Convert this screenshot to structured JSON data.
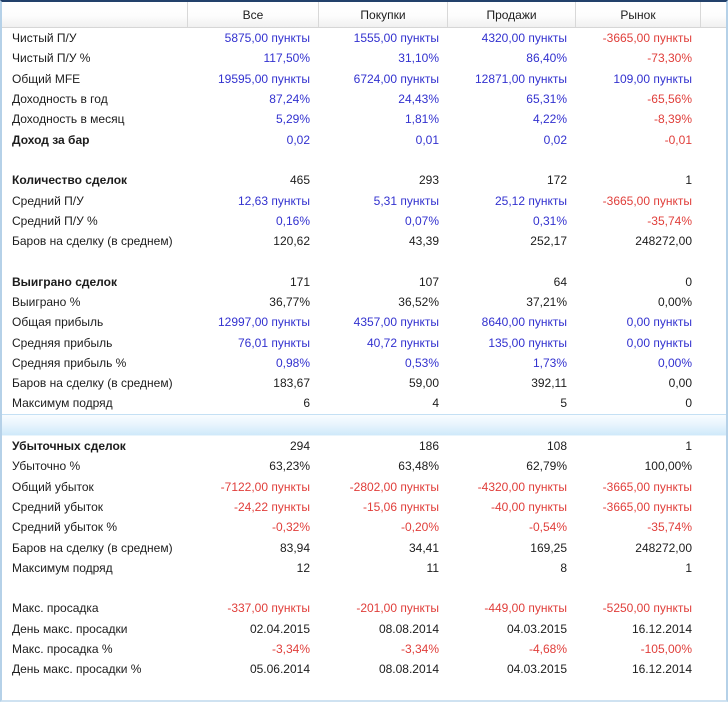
{
  "panel": {
    "columns": [
      "Все",
      "Покупки",
      "Продажи",
      "Рынок"
    ],
    "colors": {
      "positive_value": "#3231cf",
      "negative_value": "#e03e3a",
      "neutral_value": "#1c1c1c",
      "header_top_border": "#22416b",
      "panel_side_border": "#b5d1e8",
      "selected_row_highlight": "#cfe9fa"
    },
    "rows": [
      {
        "type": "data",
        "bold": false,
        "label": "Чистый П/У",
        "values": [
          {
            "t": "5875,00 пункты",
            "c": "b"
          },
          {
            "t": "1555,00 пункты",
            "c": "b"
          },
          {
            "t": "4320,00 пункты",
            "c": "b"
          },
          {
            "t": "-3665,00 пункты",
            "c": "r"
          }
        ]
      },
      {
        "type": "data",
        "bold": false,
        "label": "Чистый П/У %",
        "values": [
          {
            "t": "117,50%",
            "c": "b"
          },
          {
            "t": "31,10%",
            "c": "b"
          },
          {
            "t": "86,40%",
            "c": "b"
          },
          {
            "t": "-73,30%",
            "c": "r"
          }
        ]
      },
      {
        "type": "data",
        "bold": false,
        "label": "Общий MFE",
        "values": [
          {
            "t": "19595,00 пункты",
            "c": "b"
          },
          {
            "t": "6724,00 пункты",
            "c": "b"
          },
          {
            "t": "12871,00 пункты",
            "c": "b"
          },
          {
            "t": "109,00 пункты",
            "c": "b"
          }
        ]
      },
      {
        "type": "data",
        "bold": false,
        "label": "Доходность в год",
        "values": [
          {
            "t": "87,24%",
            "c": "b"
          },
          {
            "t": "24,43%",
            "c": "b"
          },
          {
            "t": "65,31%",
            "c": "b"
          },
          {
            "t": "-65,56%",
            "c": "r"
          }
        ]
      },
      {
        "type": "data",
        "bold": false,
        "label": "Доходность в месяц",
        "values": [
          {
            "t": "5,29%",
            "c": "b"
          },
          {
            "t": "1,81%",
            "c": "b"
          },
          {
            "t": "4,22%",
            "c": "b"
          },
          {
            "t": "-8,39%",
            "c": "r"
          }
        ]
      },
      {
        "type": "data",
        "bold": true,
        "label": "Доход за бар",
        "values": [
          {
            "t": "0,02",
            "c": "b"
          },
          {
            "t": "0,01",
            "c": "b"
          },
          {
            "t": "0,02",
            "c": "b"
          },
          {
            "t": "-0,01",
            "c": "r"
          }
        ]
      },
      {
        "type": "sp"
      },
      {
        "type": "data",
        "bold": true,
        "label": "Количество сделок",
        "values": [
          {
            "t": "465",
            "c": "k"
          },
          {
            "t": "293",
            "c": "k"
          },
          {
            "t": "172",
            "c": "k"
          },
          {
            "t": "1",
            "c": "k"
          }
        ]
      },
      {
        "type": "data",
        "bold": false,
        "label": "Средний П/У",
        "values": [
          {
            "t": "12,63 пункты",
            "c": "b"
          },
          {
            "t": "5,31 пункты",
            "c": "b"
          },
          {
            "t": "25,12 пункты",
            "c": "b"
          },
          {
            "t": "-3665,00 пункты",
            "c": "r"
          }
        ]
      },
      {
        "type": "data",
        "bold": false,
        "label": "Средний П/У %",
        "values": [
          {
            "t": "0,16%",
            "c": "b"
          },
          {
            "t": "0,07%",
            "c": "b"
          },
          {
            "t": "0,31%",
            "c": "b"
          },
          {
            "t": "-35,74%",
            "c": "r"
          }
        ]
      },
      {
        "type": "data",
        "bold": false,
        "label": "Баров на сделку (в среднем)",
        "values": [
          {
            "t": "120,62",
            "c": "k"
          },
          {
            "t": "43,39",
            "c": "k"
          },
          {
            "t": "252,17",
            "c": "k"
          },
          {
            "t": "248272,00",
            "c": "k"
          }
        ]
      },
      {
        "type": "sp"
      },
      {
        "type": "data",
        "bold": true,
        "label": "Выиграно сделок",
        "values": [
          {
            "t": "171",
            "c": "k"
          },
          {
            "t": "107",
            "c": "k"
          },
          {
            "t": "64",
            "c": "k"
          },
          {
            "t": "0",
            "c": "k"
          }
        ]
      },
      {
        "type": "data",
        "bold": false,
        "label": "Выиграно %",
        "values": [
          {
            "t": "36,77%",
            "c": "k"
          },
          {
            "t": "36,52%",
            "c": "k"
          },
          {
            "t": "37,21%",
            "c": "k"
          },
          {
            "t": "0,00%",
            "c": "k"
          }
        ]
      },
      {
        "type": "data",
        "bold": false,
        "label": "Общая прибыль",
        "values": [
          {
            "t": "12997,00 пункты",
            "c": "b"
          },
          {
            "t": "4357,00 пункты",
            "c": "b"
          },
          {
            "t": "8640,00 пункты",
            "c": "b"
          },
          {
            "t": "0,00 пункты",
            "c": "b"
          }
        ]
      },
      {
        "type": "data",
        "bold": false,
        "label": "Средняя прибыль",
        "values": [
          {
            "t": "76,01 пункты",
            "c": "b"
          },
          {
            "t": "40,72 пункты",
            "c": "b"
          },
          {
            "t": "135,00 пункты",
            "c": "b"
          },
          {
            "t": "0,00 пункты",
            "c": "b"
          }
        ]
      },
      {
        "type": "data",
        "bold": false,
        "label": "Средняя прибыль %",
        "values": [
          {
            "t": "0,98%",
            "c": "b"
          },
          {
            "t": "0,53%",
            "c": "b"
          },
          {
            "t": "1,73%",
            "c": "b"
          },
          {
            "t": "0,00%",
            "c": "b"
          }
        ]
      },
      {
        "type": "data",
        "bold": false,
        "label": "Баров на сделку (в среднем)",
        "values": [
          {
            "t": "183,67",
            "c": "k"
          },
          {
            "t": "59,00",
            "c": "k"
          },
          {
            "t": "392,11",
            "c": "k"
          },
          {
            "t": "0,00",
            "c": "k"
          }
        ]
      },
      {
        "type": "data",
        "bold": false,
        "label": "Максимум подряд",
        "values": [
          {
            "t": "6",
            "c": "k"
          },
          {
            "t": "4",
            "c": "k"
          },
          {
            "t": "5",
            "c": "k"
          },
          {
            "t": "0",
            "c": "k"
          }
        ]
      },
      {
        "type": "hl"
      },
      {
        "type": "data",
        "bold": true,
        "label": "Убыточных сделок",
        "values": [
          {
            "t": "294",
            "c": "k"
          },
          {
            "t": "186",
            "c": "k"
          },
          {
            "t": "108",
            "c": "k"
          },
          {
            "t": "1",
            "c": "k"
          }
        ]
      },
      {
        "type": "data",
        "bold": false,
        "label": "Убыточно %",
        "values": [
          {
            "t": "63,23%",
            "c": "k"
          },
          {
            "t": "63,48%",
            "c": "k"
          },
          {
            "t": "62,79%",
            "c": "k"
          },
          {
            "t": "100,00%",
            "c": "k"
          }
        ]
      },
      {
        "type": "data",
        "bold": false,
        "label": "Общий убыток",
        "values": [
          {
            "t": "-7122,00 пункты",
            "c": "r"
          },
          {
            "t": "-2802,00 пункты",
            "c": "r"
          },
          {
            "t": "-4320,00 пункты",
            "c": "r"
          },
          {
            "t": "-3665,00 пункты",
            "c": "r"
          }
        ]
      },
      {
        "type": "data",
        "bold": false,
        "label": "Средний убыток",
        "values": [
          {
            "t": "-24,22 пункты",
            "c": "r"
          },
          {
            "t": "-15,06 пункты",
            "c": "r"
          },
          {
            "t": "-40,00 пункты",
            "c": "r"
          },
          {
            "t": "-3665,00 пункты",
            "c": "r"
          }
        ]
      },
      {
        "type": "data",
        "bold": false,
        "label": "Средний убыток %",
        "values": [
          {
            "t": "-0,32%",
            "c": "r"
          },
          {
            "t": "-0,20%",
            "c": "r"
          },
          {
            "t": "-0,54%",
            "c": "r"
          },
          {
            "t": "-35,74%",
            "c": "r"
          }
        ]
      },
      {
        "type": "data",
        "bold": false,
        "label": "Баров на сделку (в среднем)",
        "values": [
          {
            "t": "83,94",
            "c": "k"
          },
          {
            "t": "34,41",
            "c": "k"
          },
          {
            "t": "169,25",
            "c": "k"
          },
          {
            "t": "248272,00",
            "c": "k"
          }
        ]
      },
      {
        "type": "data",
        "bold": false,
        "label": "Максимум подряд",
        "values": [
          {
            "t": "12",
            "c": "k"
          },
          {
            "t": "11",
            "c": "k"
          },
          {
            "t": "8",
            "c": "k"
          },
          {
            "t": "1",
            "c": "k"
          }
        ]
      },
      {
        "type": "sp"
      },
      {
        "type": "data",
        "bold": false,
        "label": "Макс. просадка",
        "values": [
          {
            "t": "-337,00 пункты",
            "c": "r"
          },
          {
            "t": "-201,00 пункты",
            "c": "r"
          },
          {
            "t": "-449,00 пункты",
            "c": "r"
          },
          {
            "t": "-5250,00 пункты",
            "c": "r"
          }
        ]
      },
      {
        "type": "data",
        "bold": false,
        "label": "День макс. просадки",
        "values": [
          {
            "t": "02.04.2015",
            "c": "k"
          },
          {
            "t": "08.08.2014",
            "c": "k"
          },
          {
            "t": "04.03.2015",
            "c": "k"
          },
          {
            "t": "16.12.2014",
            "c": "k"
          }
        ]
      },
      {
        "type": "data",
        "bold": false,
        "label": "Макс. просадка %",
        "values": [
          {
            "t": "-3,34%",
            "c": "r"
          },
          {
            "t": "-3,34%",
            "c": "r"
          },
          {
            "t": "-4,68%",
            "c": "r"
          },
          {
            "t": "-105,00%",
            "c": "r"
          }
        ]
      },
      {
        "type": "data",
        "bold": false,
        "label": "День макс. просадки %",
        "values": [
          {
            "t": "05.06.2014",
            "c": "k"
          },
          {
            "t": "08.08.2014",
            "c": "k"
          },
          {
            "t": "04.03.2015",
            "c": "k"
          },
          {
            "t": "16.12.2014",
            "c": "k"
          }
        ]
      },
      {
        "type": "sp"
      }
    ]
  }
}
